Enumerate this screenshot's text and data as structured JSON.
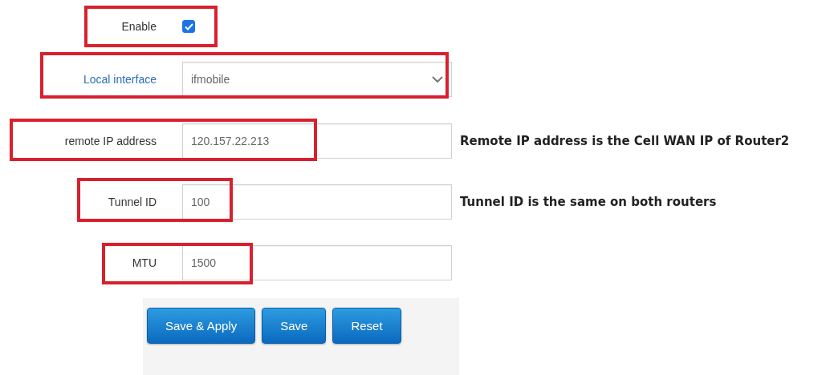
{
  "form": {
    "rows": [
      {
        "kind": "checkbox",
        "label": "Enable",
        "color": "#333333",
        "checked": true
      },
      {
        "kind": "select",
        "label": "Local interface",
        "color": "#2a6ebd",
        "value": "ifmobile"
      },
      {
        "kind": "text",
        "label": "remote IP address",
        "color": "#333333",
        "value": "120.157.22.213",
        "note": "Remote IP address is the Cell WAN IP of Router2"
      },
      {
        "kind": "text",
        "label": "Tunnel ID",
        "color": "#333333",
        "value": "100",
        "note": "Tunnel ID is the same on both routers"
      },
      {
        "kind": "text",
        "label": "MTU",
        "color": "#333333",
        "value": "1500"
      }
    ]
  },
  "buttons": [
    "Save & Apply",
    "Save",
    "Reset"
  ]
}
